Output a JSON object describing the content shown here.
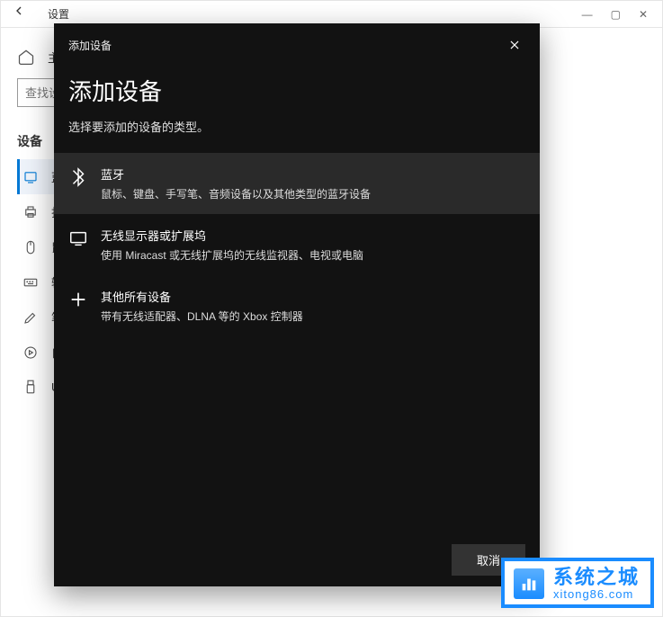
{
  "settings": {
    "title": "设置",
    "home_label": "主",
    "search_placeholder": "查找设",
    "category": "设备",
    "nav": [
      {
        "label": "蓝"
      },
      {
        "label": "打"
      },
      {
        "label": "鼠"
      },
      {
        "label": "输"
      },
      {
        "label": "笔"
      },
      {
        "label": "自"
      },
      {
        "label": "US"
      }
    ]
  },
  "dialog": {
    "small_title": "添加设备",
    "title": "添加设备",
    "subtitle": "选择要添加的设备的类型。",
    "options": [
      {
        "title": "蓝牙",
        "desc": "鼠标、键盘、手写笔、音频设备以及其他类型的蓝牙设备"
      },
      {
        "title": "无线显示器或扩展坞",
        "desc": "使用 Miracast 或无线扩展坞的无线监视器、电视或电脑"
      },
      {
        "title": "其他所有设备",
        "desc": "带有无线适配器、DLNA 等的 Xbox 控制器"
      }
    ],
    "cancel": "取消"
  },
  "watermark": {
    "name": "系统之城",
    "domain": "xitong86.com"
  }
}
